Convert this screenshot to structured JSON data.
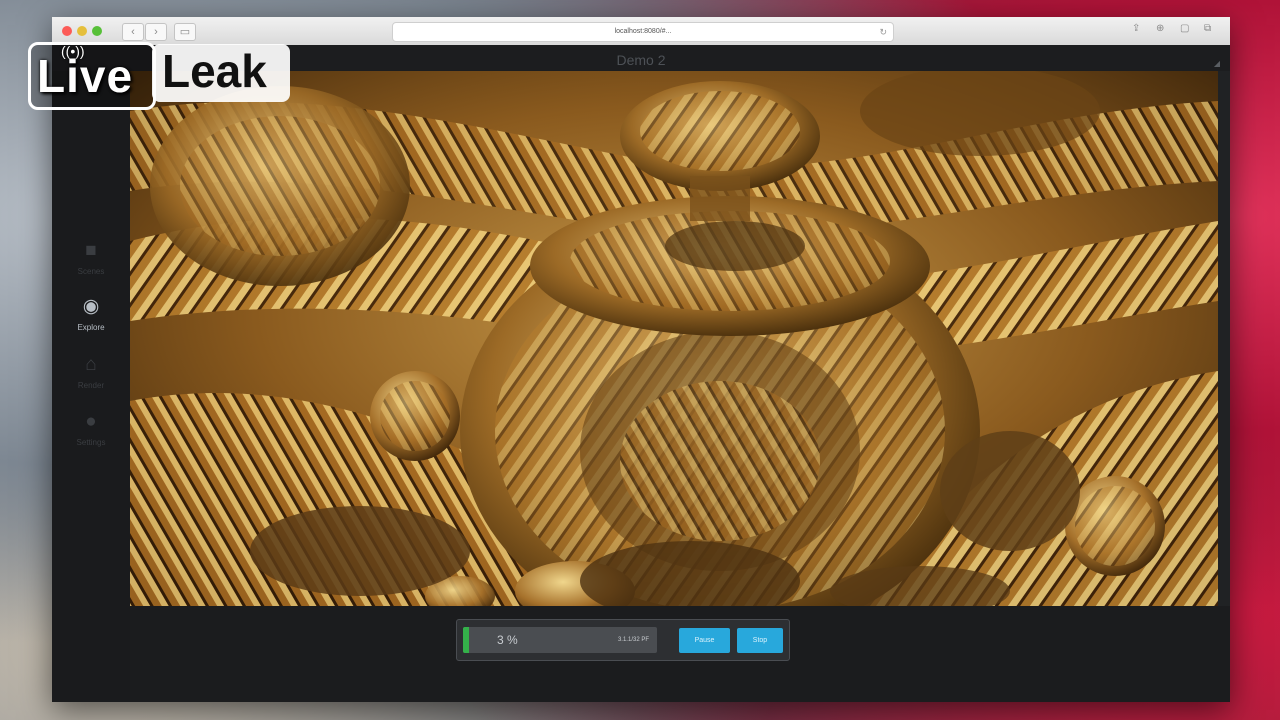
{
  "browser": {
    "url": "localhost:8080/#...",
    "back_icon": "chevron-left-icon",
    "forward_icon": "chevron-right-icon",
    "reload_icon": "reload-icon"
  },
  "app": {
    "title": "Demo 2"
  },
  "sidebar": {
    "items": [
      {
        "icon": "■",
        "icon_name": "folder-icon",
        "label": "Scenes",
        "active": false
      },
      {
        "icon": "◉",
        "icon_name": "eye-icon",
        "label": "Explore",
        "active": true
      },
      {
        "icon": "⌂",
        "icon_name": "render-icon",
        "label": "Render",
        "active": false
      },
      {
        "icon": "●",
        "icon_name": "settings-icon",
        "label": "Settings",
        "active": false
      }
    ]
  },
  "progress": {
    "percent_label": "3 %",
    "percent_value": 0.03,
    "samples_label": "3.1.1/32 PF",
    "pause_label": "Pause",
    "stop_label": "Stop",
    "fill_color": "#34b14a",
    "button_color": "#28a8dc"
  },
  "watermark": {
    "live": "Live",
    "leak": "Leak"
  }
}
